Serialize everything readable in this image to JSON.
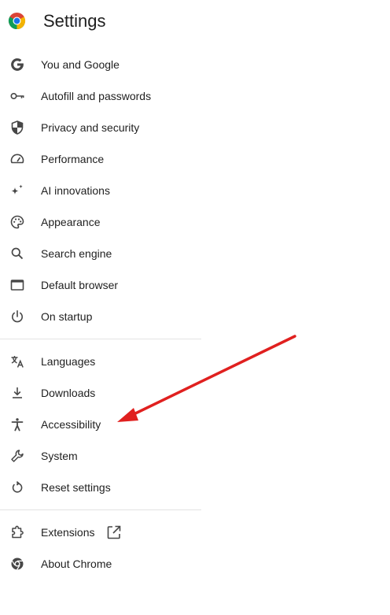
{
  "header": {
    "title": "Settings",
    "logo_icon": "chrome-logo-icon"
  },
  "nav": {
    "group1": [
      {
        "label": "You and Google",
        "icon": "google-g-icon"
      },
      {
        "label": "Autofill and passwords",
        "icon": "key-icon"
      },
      {
        "label": "Privacy and security",
        "icon": "shield-icon"
      },
      {
        "label": "Performance",
        "icon": "speedometer-icon"
      },
      {
        "label": "AI innovations",
        "icon": "sparkle-icon"
      },
      {
        "label": "Appearance",
        "icon": "palette-icon"
      },
      {
        "label": "Search engine",
        "icon": "search-icon"
      },
      {
        "label": "Default browser",
        "icon": "browser-window-icon"
      },
      {
        "label": "On startup",
        "icon": "power-icon"
      }
    ],
    "group2": [
      {
        "label": "Languages",
        "icon": "translate-icon"
      },
      {
        "label": "Downloads",
        "icon": "download-icon"
      },
      {
        "label": "Accessibility",
        "icon": "accessibility-icon"
      },
      {
        "label": "System",
        "icon": "wrench-icon"
      },
      {
        "label": "Reset settings",
        "icon": "reset-icon"
      }
    ],
    "group3": [
      {
        "label": "Extensions",
        "icon": "extension-icon",
        "trailing_icon": "open-in-new-icon"
      },
      {
        "label": "About Chrome",
        "icon": "chrome-outline-icon"
      }
    ]
  },
  "annotation": {
    "arrow_color": "#e0201f",
    "points_to": "Accessibility"
  },
  "colors": {
    "text": "#1f1f1f",
    "icon": "#474747",
    "divider": "#e3e3e3"
  }
}
